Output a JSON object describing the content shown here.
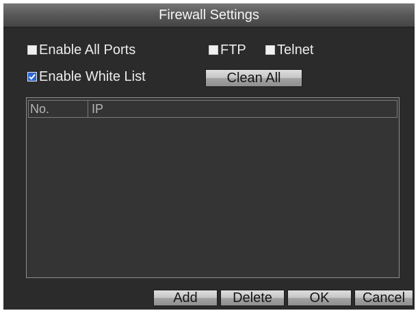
{
  "window": {
    "title": "Firewall Settings"
  },
  "ports": {
    "enable_all_ports": {
      "label": "Enable All Ports",
      "checked": false
    },
    "ftp": {
      "label": "FTP",
      "checked": false
    },
    "telnet": {
      "label": "Telnet",
      "checked": false
    }
  },
  "white_list": {
    "enable": {
      "label": "Enable White List",
      "checked": true
    },
    "clean_all_label": "Clean All",
    "table": {
      "columns": [
        {
          "label": "No."
        },
        {
          "label": "IP"
        }
      ],
      "rows": []
    }
  },
  "footer": {
    "add_label": "Add",
    "delete_label": "Delete",
    "ok_label": "OK",
    "cancel_label": "Cancel"
  },
  "colors": {
    "panel_background": "#2b2b2b",
    "table_background": "#343434",
    "text": "#ececec",
    "checkbox_checked": "#2c66d4",
    "button_text": "#141414"
  },
  "icons": {
    "checkbox_checked": "check-icon"
  }
}
